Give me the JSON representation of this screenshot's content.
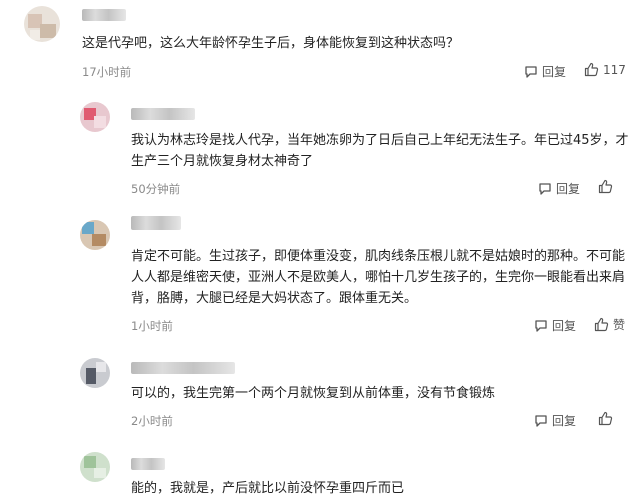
{
  "comments": [
    {
      "text": "这是代孕吧，这么大年龄怀孕生子后，身体能恢复到这种状态吗？",
      "time": "17小时前",
      "reply_label": "回复",
      "like_count": "117"
    },
    {
      "text_line1": "我认为林志玲是找人代孕，当年她冻卵为了日后自己上年纪无法生子。年已过45岁，才",
      "text_line2": "生产三个月就恢复身材太神奇了",
      "time": "50分钟前",
      "reply_label": "回复",
      "like_count": ""
    },
    {
      "text_line1": "肯定不可能。生过孩子，即便体重没变，肌肉线条压根儿就不是姑娘时的那种。不可能",
      "text_line2": "人人都是维密天使，亚洲人不是欧美人，哪怕十几岁生孩子的，生完你一眼能看出来肩",
      "text_line3": "背，胳膊，大腿已经是大妈状态了。跟体重无关。",
      "time": "1小时前",
      "reply_label": "回复",
      "like_label": "赞"
    },
    {
      "text": "可以的，我生完第一个两个月就恢复到从前体重，没有节食锻炼",
      "time": "2小时前",
      "reply_label": "回复"
    },
    {
      "text": "能的，我就是，产后就比以前没怀孕重四斤而已"
    }
  ],
  "icons": {
    "reply": "comment-bubble-icon",
    "like": "thumbs-up-icon"
  }
}
